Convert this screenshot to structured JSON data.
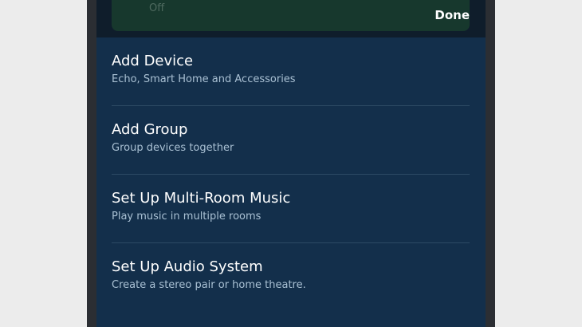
{
  "header": {
    "status_text": "Off",
    "done_label": "Done"
  },
  "menu": {
    "items": [
      {
        "title": "Add Device",
        "subtitle": "Echo, Smart Home and Accessories"
      },
      {
        "title": "Add Group",
        "subtitle": "Group devices together"
      },
      {
        "title": "Set Up Multi-Room Music",
        "subtitle": "Play music in multiple rooms"
      },
      {
        "title": "Set Up Audio System",
        "subtitle": "Create a stereo pair or home theatre."
      }
    ]
  },
  "colors": {
    "background": "#ececec",
    "device_frame": "#2b2e33",
    "menu_background": "#132f4b",
    "header_background": "#0f1d2b",
    "card_background": "#17382d",
    "title_text": "#ffffff",
    "subtitle_text": "#a9c0d3",
    "divider": "#2d4a64"
  }
}
